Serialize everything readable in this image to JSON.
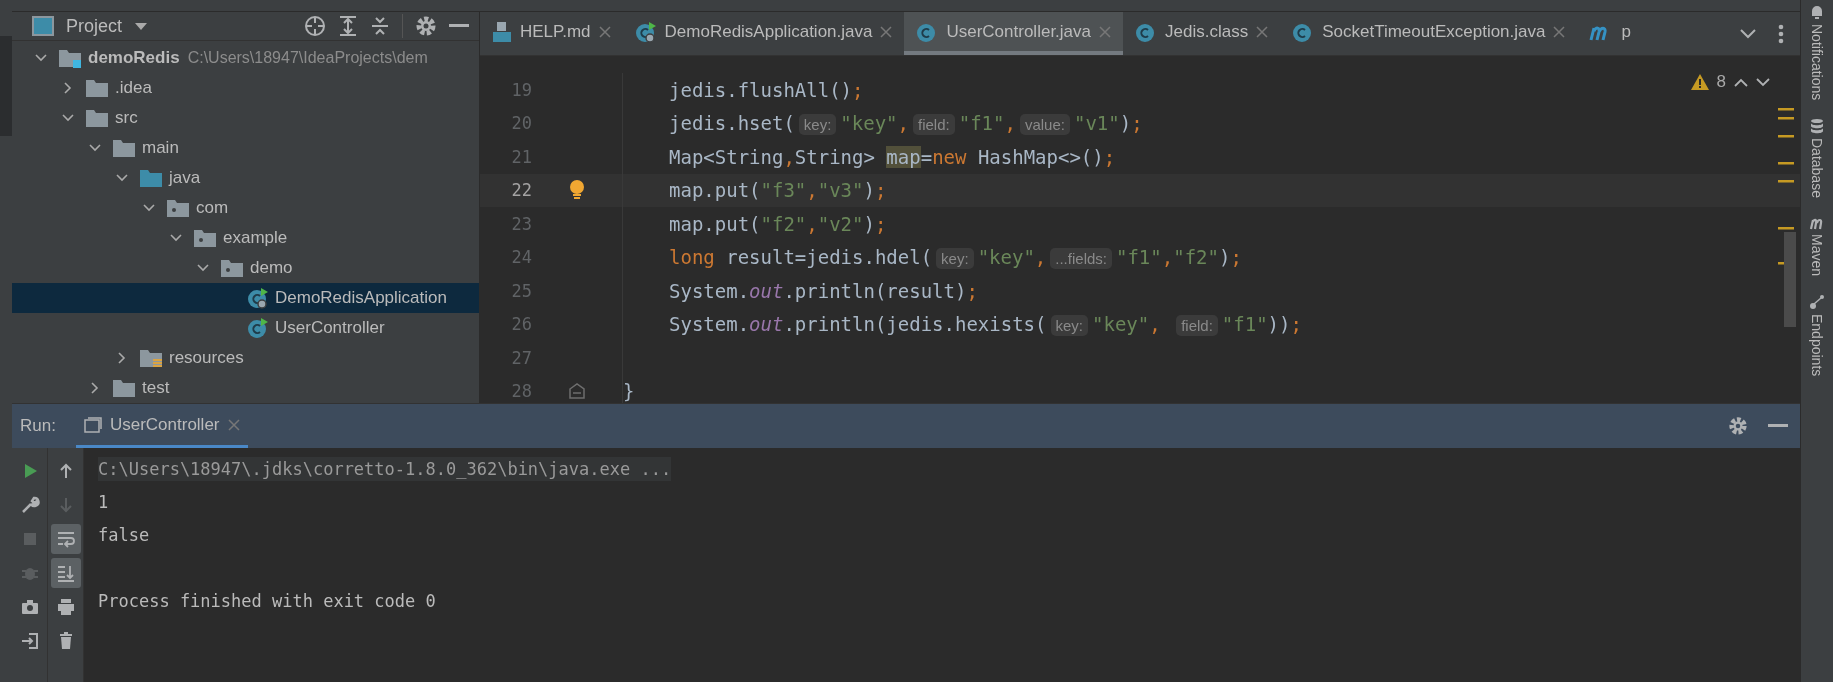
{
  "project_panel": {
    "title": "Project",
    "tree": [
      {
        "label": "demoRedis",
        "path": "C:\\Users\\18947\\IdeaProjects\\dem",
        "kind": "module",
        "expanded": true,
        "selected": false,
        "children": [
          {
            "label": ".idea",
            "kind": "folder",
            "expanded": false,
            "selected": false
          },
          {
            "label": "src",
            "kind": "folder",
            "expanded": true,
            "selected": false,
            "children": [
              {
                "label": "main",
                "kind": "folder",
                "expanded": true,
                "selected": false,
                "children": [
                  {
                    "label": "java",
                    "kind": "source-folder",
                    "expanded": true,
                    "selected": false,
                    "children": [
                      {
                        "label": "com",
                        "kind": "package",
                        "expanded": true,
                        "selected": false,
                        "children": [
                          {
                            "label": "example",
                            "kind": "package",
                            "expanded": true,
                            "selected": false,
                            "children": [
                              {
                                "label": "demo",
                                "kind": "package",
                                "expanded": true,
                                "selected": false,
                                "children": [
                                  {
                                    "label": "DemoRedisApplication",
                                    "kind": "spring-class",
                                    "selected": true
                                  },
                                  {
                                    "label": "UserController",
                                    "kind": "run-class",
                                    "selected": false
                                  }
                                ]
                              }
                            ]
                          }
                        ]
                      }
                    ]
                  },
                  {
                    "label": "resources",
                    "kind": "resources-folder",
                    "expanded": false,
                    "selected": false
                  }
                ]
              },
              {
                "label": "test",
                "kind": "folder",
                "expanded": false,
                "selected": false
              }
            ]
          }
        ]
      }
    ]
  },
  "editor": {
    "tabs": [
      {
        "label": "HELP.md",
        "kind": "markdown",
        "selected": false
      },
      {
        "label": "DemoRedisApplication.java",
        "kind": "spring-class",
        "selected": false
      },
      {
        "label": "UserController.java",
        "kind": "class",
        "selected": true
      },
      {
        "label": "Jedis.class",
        "kind": "class",
        "selected": false
      },
      {
        "label": "SocketTimeoutException.java",
        "kind": "class",
        "selected": false
      },
      {
        "label": "p",
        "kind": "maven",
        "selected": false
      }
    ],
    "warnings": "8",
    "lines": [
      {
        "number": "19",
        "current": false,
        "kind": "body",
        "tokens": [
          {
            "kind": "plain",
            "text": "jedis.flushAll()"
          },
          {
            "kind": "punct",
            "text": ";"
          }
        ]
      },
      {
        "number": "20",
        "current": false,
        "kind": "body",
        "tokens": [
          {
            "kind": "plain",
            "text": "jedis.hset("
          },
          {
            "kind": "hint",
            "text": "key:"
          },
          {
            "kind": "string",
            "text": "\"key\""
          },
          {
            "kind": "punct",
            "text": ","
          },
          {
            "kind": "hint",
            "text": "field:"
          },
          {
            "kind": "string",
            "text": "\"f1\""
          },
          {
            "kind": "punct",
            "text": ","
          },
          {
            "kind": "hint",
            "text": "value:"
          },
          {
            "kind": "string",
            "text": "\"v1\""
          },
          {
            "kind": "plain",
            "text": ")"
          },
          {
            "kind": "punct",
            "text": ";"
          }
        ]
      },
      {
        "number": "21",
        "current": false,
        "kind": "body",
        "tokens": [
          {
            "kind": "plain",
            "text": "Map<String"
          },
          {
            "kind": "punct",
            "text": ","
          },
          {
            "kind": "plain",
            "text": "String> "
          },
          {
            "kind": "highlight",
            "text": "map"
          },
          {
            "kind": "plain",
            "text": "="
          },
          {
            "kind": "keyword",
            "text": "new"
          },
          {
            "kind": "plain",
            "text": " HashMap<>()"
          },
          {
            "kind": "punct",
            "text": ";"
          }
        ]
      },
      {
        "number": "22",
        "current": true,
        "kind": "bulb",
        "tokens": [
          {
            "kind": "plain",
            "text": "map.put("
          },
          {
            "kind": "string",
            "text": "\"f3\""
          },
          {
            "kind": "punct",
            "text": ","
          },
          {
            "kind": "string",
            "text": "\"v3\""
          },
          {
            "kind": "plain",
            "text": ")"
          },
          {
            "kind": "punct",
            "text": ";"
          }
        ]
      },
      {
        "number": "23",
        "current": false,
        "kind": "body",
        "tokens": [
          {
            "kind": "plain",
            "text": "map.put("
          },
          {
            "kind": "string",
            "text": "\"f2\""
          },
          {
            "kind": "punct",
            "text": ","
          },
          {
            "kind": "string",
            "text": "\"v2\""
          },
          {
            "kind": "plain",
            "text": ")"
          },
          {
            "kind": "punct",
            "text": ";"
          }
        ]
      },
      {
        "number": "24",
        "current": false,
        "kind": "body",
        "tokens": [
          {
            "kind": "keyword",
            "text": "long"
          },
          {
            "kind": "plain",
            "text": " result=jedis.hdel("
          },
          {
            "kind": "hint",
            "text": "key:"
          },
          {
            "kind": "string",
            "text": "\"key\""
          },
          {
            "kind": "punct",
            "text": ","
          },
          {
            "kind": "hint",
            "text": "...fields:"
          },
          {
            "kind": "string",
            "text": "\"f1\""
          },
          {
            "kind": "punct",
            "text": ","
          },
          {
            "kind": "string",
            "text": "\"f2\""
          },
          {
            "kind": "plain",
            "text": ")"
          },
          {
            "kind": "punct",
            "text": ";"
          }
        ]
      },
      {
        "number": "25",
        "current": false,
        "kind": "body",
        "tokens": [
          {
            "kind": "plain",
            "text": "System."
          },
          {
            "kind": "static",
            "text": "out"
          },
          {
            "kind": "plain",
            "text": ".println(result)"
          },
          {
            "kind": "punct",
            "text": ";"
          }
        ]
      },
      {
        "number": "26",
        "current": false,
        "kind": "body",
        "tokens": [
          {
            "kind": "plain",
            "text": "System."
          },
          {
            "kind": "static",
            "text": "out"
          },
          {
            "kind": "plain",
            "text": ".println(jedis.hexists("
          },
          {
            "kind": "hint",
            "text": "key:"
          },
          {
            "kind": "string",
            "text": "\"key\""
          },
          {
            "kind": "punct",
            "text": ", "
          },
          {
            "kind": "hint",
            "text": "field:"
          },
          {
            "kind": "string",
            "text": "\"f1\""
          },
          {
            "kind": "plain",
            "text": "))"
          },
          {
            "kind": "punct",
            "text": ";"
          }
        ]
      },
      {
        "number": "27",
        "current": false,
        "kind": "blank"
      },
      {
        "number": "28",
        "current": false,
        "kind": "close",
        "tokens": [
          {
            "kind": "plain",
            "text": "}"
          }
        ]
      }
    ]
  },
  "run_panel": {
    "title": "Run:",
    "tabs": [
      {
        "label": "UserController",
        "selected": true
      }
    ],
    "tools": [
      {
        "kind": "run",
        "disabled": false
      },
      {
        "kind": "wrench",
        "disabled": false
      },
      {
        "kind": "stop",
        "disabled": true
      },
      {
        "kind": "bug",
        "disabled": true
      },
      {
        "kind": "camera",
        "disabled": false
      },
      {
        "kind": "login",
        "disabled": false
      }
    ],
    "console_tools": [
      {
        "kind": "up",
        "on": false,
        "disabled": false
      },
      {
        "kind": "down",
        "on": false,
        "disabled": true
      },
      {
        "kind": "wrap",
        "on": true,
        "disabled": false
      },
      {
        "kind": "scroll-end",
        "on": true,
        "disabled": false
      },
      {
        "kind": "print",
        "on": false,
        "disabled": false
      },
      {
        "kind": "trash",
        "on": false,
        "disabled": false
      }
    ],
    "output": [
      {
        "kind": "command",
        "text": "C:\\Users\\18947\\.jdks\\corretto-1.8.0_362\\bin\\java.exe ..."
      },
      {
        "kind": "output",
        "text": "1"
      },
      {
        "kind": "output",
        "text": "false"
      },
      {
        "kind": "exit",
        "text": "Process finished with exit code 0"
      }
    ]
  },
  "right_toolbar": [
    {
      "label": "Notifications",
      "kind": "bell"
    },
    {
      "label": "Database",
      "kind": "database"
    },
    {
      "label": "Maven",
      "kind": "maven"
    },
    {
      "label": "Endpoints",
      "kind": "endpoints"
    }
  ]
}
